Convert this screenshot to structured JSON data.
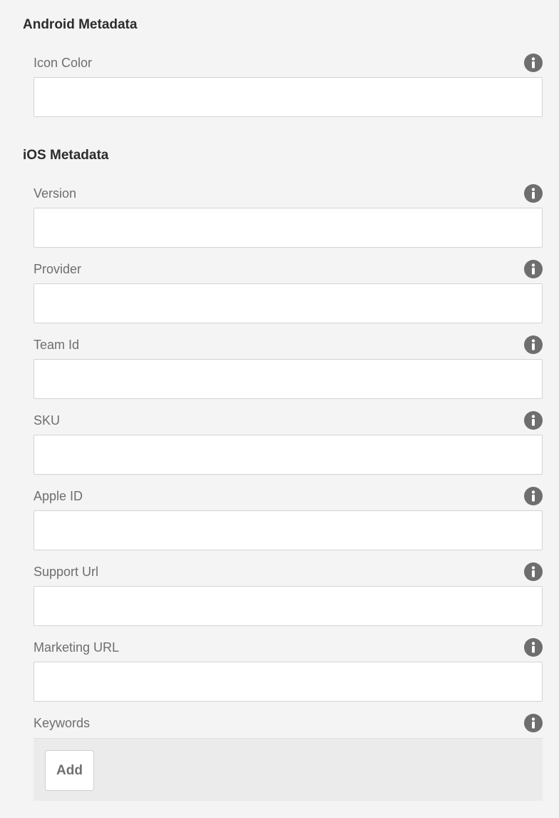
{
  "android": {
    "heading": "Android Metadata",
    "fields": {
      "icon_color": {
        "label": "Icon Color",
        "value": ""
      }
    }
  },
  "ios": {
    "heading": "iOS Metadata",
    "fields": {
      "version": {
        "label": "Version",
        "value": ""
      },
      "provider": {
        "label": "Provider",
        "value": ""
      },
      "team_id": {
        "label": "Team Id",
        "value": ""
      },
      "sku": {
        "label": "SKU",
        "value": ""
      },
      "apple_id": {
        "label": "Apple ID",
        "value": ""
      },
      "support_url": {
        "label": "Support Url",
        "value": ""
      },
      "marketing_url": {
        "label": "Marketing URL",
        "value": ""
      },
      "keywords": {
        "label": "Keywords",
        "add_label": "Add"
      }
    }
  },
  "icons": {
    "info": "info-icon"
  },
  "colors": {
    "background": "#f4f4f4",
    "heading": "#2c2c2c",
    "label": "#6e6e6e",
    "input_border": "#d4d4d4",
    "icon": "#6e6e6e",
    "keywords_panel": "#ebebeb"
  }
}
